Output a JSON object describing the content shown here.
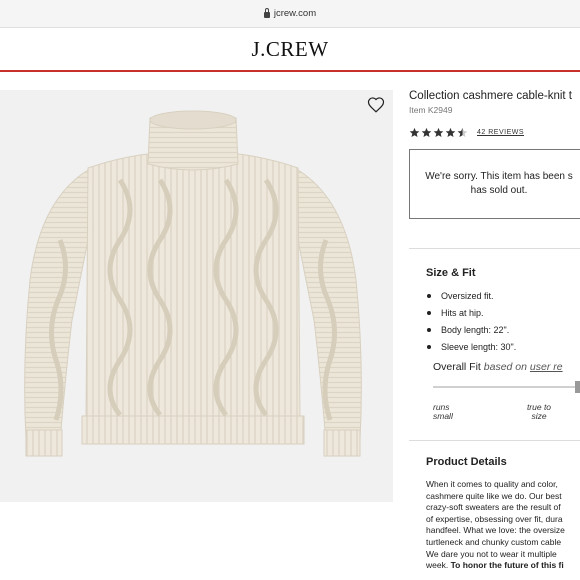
{
  "browser": {
    "url": "jcrew.com"
  },
  "header": {
    "logo": "J.CREW"
  },
  "product": {
    "title": "Collection cashmere cable-knit t",
    "item_number": "Item K2949",
    "rating": 4.5,
    "reviews_label": "42 REVIEWS",
    "sold_out_message": "We're sorry. This item has been s has sold out."
  },
  "size_fit": {
    "heading": "Size & Fit",
    "bullets": [
      "Oversized fit.",
      "Hits at hip.",
      "Body length: 22\".",
      "Sleeve length: 30\"."
    ],
    "overall_fit_label": "Overall Fit",
    "based_on": "based on",
    "user_reviews_link": "user re",
    "scale_left": "runs small",
    "scale_mid": "true to size"
  },
  "details": {
    "heading": "Product Details",
    "lines": [
      "When it comes to quality and color,",
      "cashmere quite like we do. Our best",
      "crazy-soft sweaters are the result of",
      "of expertise, obsessing over fit, dura",
      "handfeel. What we love: the oversize",
      "turtleneck and chunky custom cable",
      "We dare you not to wear it multiple"
    ],
    "last_line_prefix": "week. ",
    "last_line_bold": "To honor the future of this fi"
  },
  "colors": {
    "accent_red": "#c9302c",
    "sweater": "#eee8dc",
    "image_bg": "#f1f1f1"
  }
}
